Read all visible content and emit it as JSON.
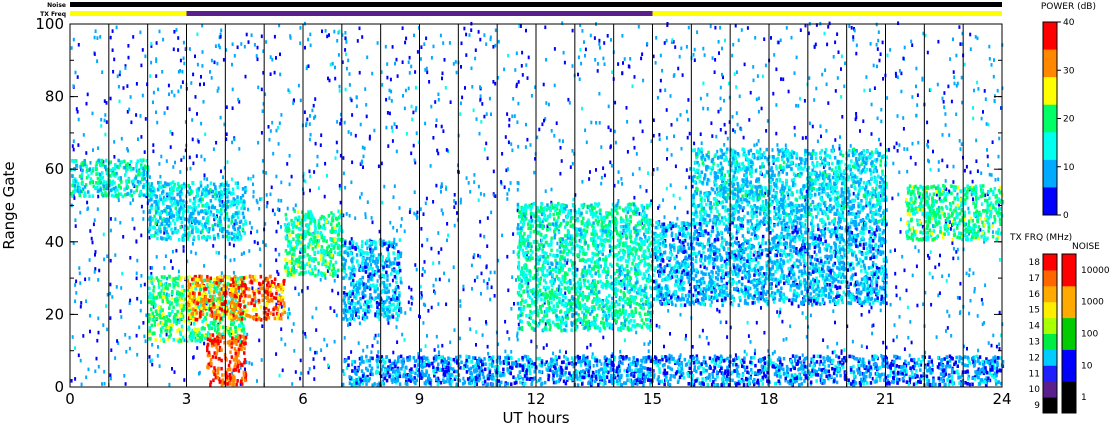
{
  "chart_data": {
    "type": "heatmap",
    "xlabel": "UT hours",
    "ylabel": "Range Gate",
    "xlim": [
      0,
      24
    ],
    "ylim": [
      0,
      100
    ],
    "x_ticks": [
      "0",
      "3",
      "6",
      "9",
      "12",
      "15",
      "18",
      "21",
      "24"
    ],
    "y_ticks": [
      "0",
      "20",
      "40",
      "60",
      "80",
      "100"
    ],
    "vertical_lines_ut": [
      1,
      2,
      3,
      4,
      5,
      6,
      7,
      8,
      9,
      10,
      11,
      12,
      13,
      14,
      15,
      16,
      17,
      18,
      19,
      20,
      21,
      22,
      23
    ],
    "top_bars": {
      "noise_label": "Noise",
      "txfreq_label": "TX Freq",
      "noise_color": "#000000",
      "txfreq_segments": [
        {
          "from": 0,
          "to": 3,
          "color": "#ffff00"
        },
        {
          "from": 3,
          "to": 15,
          "color": "#5a1f8c"
        },
        {
          "from": 15,
          "to": 24,
          "color": "#ffff00"
        }
      ]
    },
    "echo_bands": [
      {
        "ut": [
          0,
          2
        ],
        "gate": [
          52,
          62
        ],
        "power_db": 15
      },
      {
        "ut": [
          2,
          4.5
        ],
        "gate": [
          40,
          56
        ],
        "power_db": 12
      },
      {
        "ut": [
          2,
          4.5
        ],
        "gate": [
          12,
          30
        ],
        "power_db": 20
      },
      {
        "ut": [
          3,
          5.5
        ],
        "gate": [
          18,
          30
        ],
        "power_db": 32
      },
      {
        "ut": [
          3.5,
          4.5
        ],
        "gate": [
          0,
          14
        ],
        "power_db": 35
      },
      {
        "ut": [
          5.5,
          7
        ],
        "gate": [
          30,
          48
        ],
        "power_db": 18
      },
      {
        "ut": [
          7,
          8.5
        ],
        "gate": [
          18,
          40
        ],
        "power_db": 10
      },
      {
        "ut": [
          11.5,
          15
        ],
        "gate": [
          15,
          50
        ],
        "power_db": 16
      },
      {
        "ut": [
          15,
          21
        ],
        "gate": [
          22,
          45
        ],
        "power_db": 10
      },
      {
        "ut": [
          16,
          21
        ],
        "gate": [
          45,
          65
        ],
        "power_db": 12
      },
      {
        "ut": [
          21.5,
          24
        ],
        "gate": [
          40,
          55
        ],
        "power_db": 18
      },
      {
        "ut": [
          7,
          24
        ],
        "gate": [
          0,
          8
        ],
        "power_db": 8
      }
    ],
    "power_colorbar": {
      "title": "POWER (dB)",
      "ticks": [
        "0",
        "10",
        "20",
        "30",
        "40"
      ],
      "range": [
        0,
        40
      ],
      "colors": [
        "#0000ff",
        "#00aaff",
        "#00ffee",
        "#00ff66",
        "#ffff00",
        "#ff8800",
        "#ff0000"
      ]
    },
    "txfreq_colorbar": {
      "title": "TX FRQ (MHz)",
      "ticks": [
        "9",
        "10",
        "11",
        "12",
        "13",
        "14",
        "15",
        "16",
        "17",
        "18"
      ],
      "colors": [
        "#000000",
        "#5a1f8c",
        "#2020ff",
        "#00ccff",
        "#00ee44",
        "#aaff00",
        "#ffee00",
        "#ffaa00",
        "#ff6600",
        "#ff0000"
      ]
    },
    "noise_colorbar": {
      "title": "NOISE",
      "ticks": [
        "1",
        "10",
        "100",
        "1000",
        "10000"
      ],
      "colors": [
        "#000000",
        "#0000ff",
        "#00cc00",
        "#ffaa00",
        "#ff0000"
      ]
    }
  }
}
